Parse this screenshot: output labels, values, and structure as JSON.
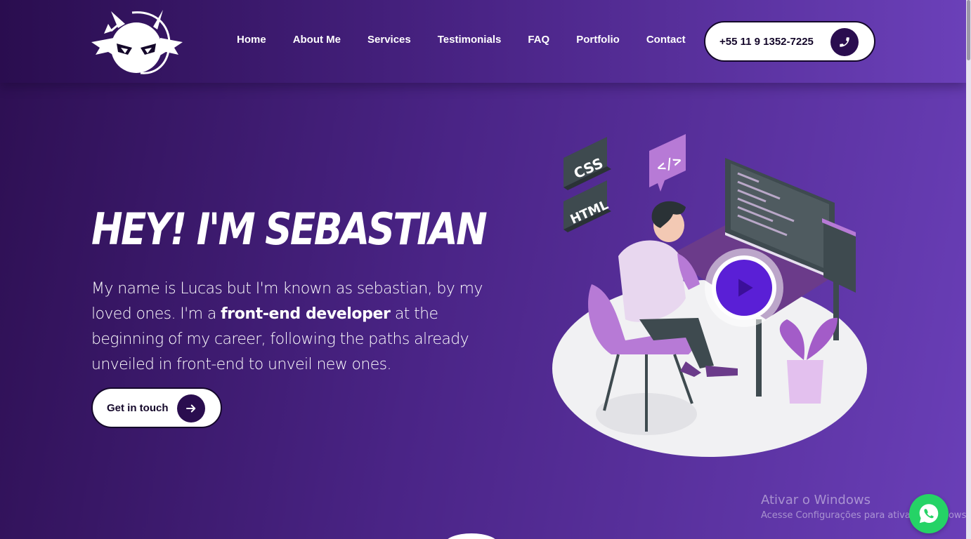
{
  "nav": {
    "items": [
      "Home",
      "About Me",
      "Services",
      "Testimonials",
      "FAQ",
      "Portfolio",
      "Contact"
    ]
  },
  "phone": {
    "number": "+55 11 9 1352-7225",
    "icon": "phone-icon"
  },
  "hero": {
    "title": "HEY! I'M SEBASTIAN",
    "intro_before": "My name is Lucas but I'm known as sebastian, by my loved ones. I'm a ",
    "intro_bold": "front-end developer",
    "intro_after": " at the beginning of my career, following the paths already unveiled in front-end to unveil new ones.",
    "cta_label": "Get in touch",
    "cta_icon": "arrow-right-icon"
  },
  "illustration": {
    "css_tile": "CSS",
    "html_tile": "HTML",
    "code_bubble": "</>"
  },
  "watermark": {
    "line1": "Ativar o Windows",
    "line2": "Acesse Configurações para ativar o Windows."
  },
  "colors": {
    "bg_dark": "#2d0f52",
    "bg_light": "#6a3fb8",
    "accent": "#5a1fd6",
    "button_icon_bg": "#2a0d4f",
    "whatsapp": "#25d366"
  }
}
